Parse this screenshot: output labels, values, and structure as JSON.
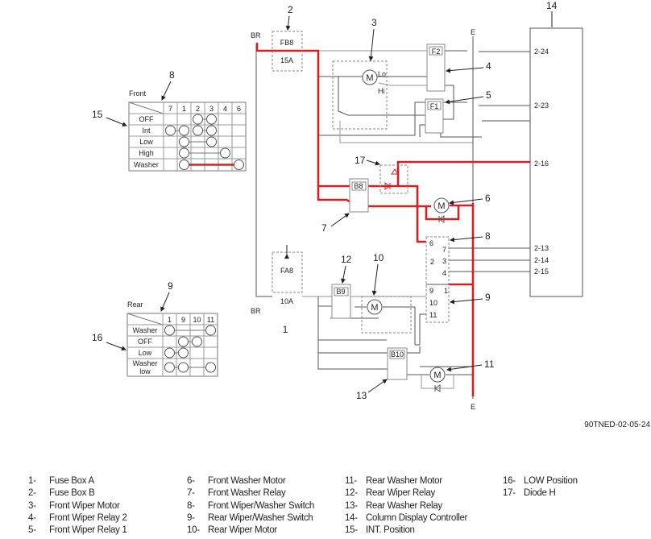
{
  "diagram": {
    "labels": {
      "br_top": "BR",
      "br_bottom": "BR",
      "e_top": "E",
      "e_bottom": "E",
      "fuse_b_name": "FB8",
      "fuse_b_rating": "15A",
      "fuse_a_name": "FA8",
      "fuse_a_rating": "10A",
      "relay_f2": "F2",
      "relay_f1": "F1",
      "relay_b8": "B8",
      "relay_b9": "B9",
      "relay_b10": "B10",
      "motor": "M",
      "lo": "Lo",
      "hi": "Hi",
      "sw_pins": [
        "6",
        "2",
        "7",
        "3",
        "4",
        "9",
        "1",
        "10",
        "11"
      ],
      "controller_pins": [
        "2-24",
        "2-23",
        "2-16",
        "2-13",
        "2-14",
        "2-15"
      ],
      "figure_id": "90TNED-02-05-24"
    },
    "callouts": [
      "1",
      "2",
      "3",
      "4",
      "5",
      "6",
      "7",
      "8",
      "9",
      "10",
      "11",
      "12",
      "13",
      "14",
      "15",
      "16",
      "17"
    ],
    "accent_color": "#d42020"
  },
  "front_table": {
    "title": "Front",
    "columns": [
      "7",
      "1",
      "2",
      "3",
      "4",
      "6"
    ],
    "rows": [
      {
        "label": "OFF",
        "groups": [
          [
            "2",
            "3"
          ]
        ]
      },
      {
        "label": "Int",
        "groups": [
          [
            "7",
            "1"
          ],
          [
            "2",
            "3"
          ]
        ]
      },
      {
        "label": "Low",
        "groups": [
          [
            "1",
            "3"
          ]
        ]
      },
      {
        "label": "High",
        "groups": [
          [
            "1",
            "4"
          ]
        ]
      },
      {
        "label": "Washer",
        "groups": [
          [
            "1",
            "6"
          ]
        ],
        "highlight": true
      }
    ]
  },
  "rear_table": {
    "title": "Rear",
    "columns": [
      "1",
      "9",
      "10",
      "11"
    ],
    "rows": [
      {
        "label": "Washer",
        "groups": [
          [
            "1",
            "11"
          ]
        ]
      },
      {
        "label": "OFF",
        "groups": [
          [
            "9",
            "10"
          ]
        ]
      },
      {
        "label": "Low",
        "groups": [
          [
            "1",
            "9"
          ]
        ]
      },
      {
        "label": "Washer low",
        "groups": [
          [
            "1",
            "9"
          ],
          [
            "9",
            "11"
          ]
        ]
      }
    ]
  },
  "legend": [
    {
      "num": "1-",
      "text": "Fuse Box A"
    },
    {
      "num": "2-",
      "text": "Fuse Box B"
    },
    {
      "num": "3-",
      "text": "Front Wiper Motor"
    },
    {
      "num": "4-",
      "text": "Front Wiper Relay 2"
    },
    {
      "num": "5-",
      "text": "Front Wiper Relay 1"
    },
    {
      "num": "6-",
      "text": "Front Washer Motor"
    },
    {
      "num": "7-",
      "text": "Front Washer Relay"
    },
    {
      "num": "8-",
      "text": "Front Wiper/Washer Switch"
    },
    {
      "num": "9-",
      "text": "Rear Wiper/Washer Switch"
    },
    {
      "num": "10-",
      "text": "Rear Wiper Motor"
    },
    {
      "num": "11-",
      "text": "Rear Washer Motor"
    },
    {
      "num": "12-",
      "text": "Rear Wiper Relay"
    },
    {
      "num": "13-",
      "text": "Rear Washer Relay"
    },
    {
      "num": "14-",
      "text": "Column Display Controller"
    },
    {
      "num": "15-",
      "text": "INT. Position"
    },
    {
      "num": "16-",
      "text": "LOW Position"
    },
    {
      "num": "17-",
      "text": "Diode H"
    }
  ]
}
